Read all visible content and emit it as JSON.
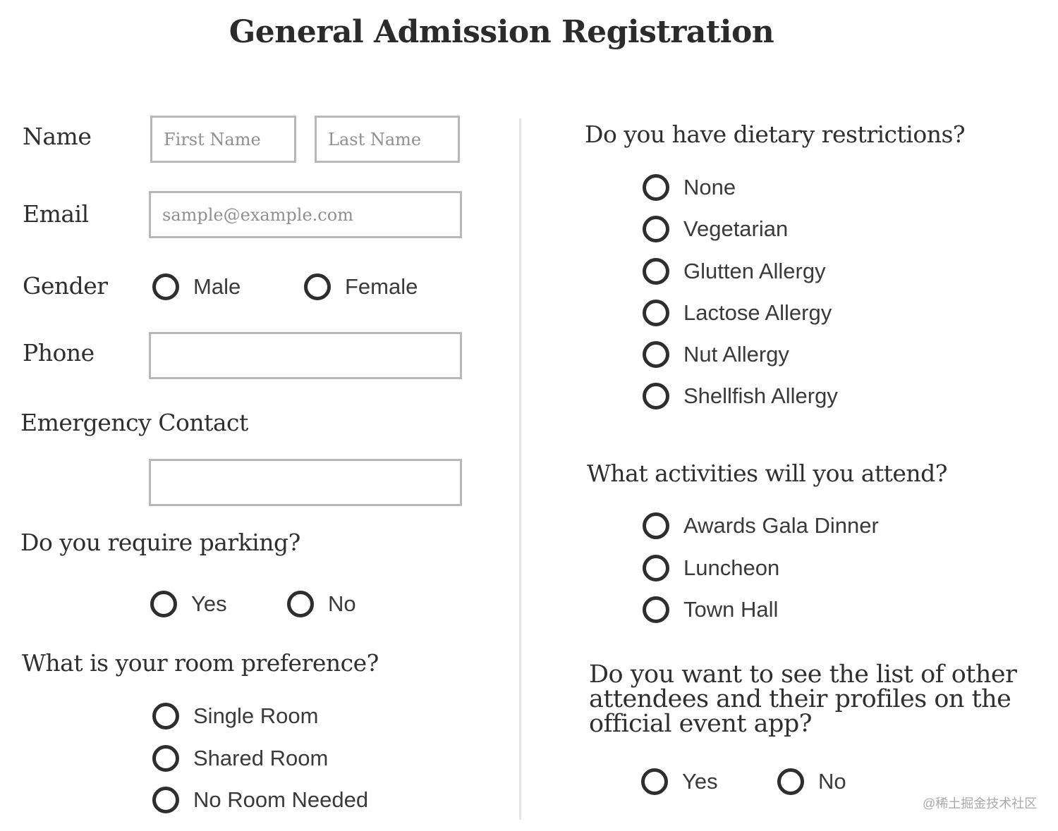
{
  "title": "General Admission Registration",
  "left": {
    "name": {
      "label": "Name",
      "first_placeholder": "First Name",
      "last_placeholder": "Last Name"
    },
    "email": {
      "label": "Email",
      "placeholder": "sample@example.com"
    },
    "gender": {
      "label": "Gender",
      "options": [
        "Male",
        "Female"
      ]
    },
    "phone": {
      "label": "Phone",
      "value": ""
    },
    "emergency": {
      "label": "Emergency Contact",
      "value": ""
    },
    "parking": {
      "question": "Do you require parking?",
      "options": [
        "Yes",
        "No"
      ]
    },
    "room": {
      "question": "What is your room preference?",
      "options": [
        "Single Room",
        "Shared Room",
        "No Room Needed"
      ]
    }
  },
  "right": {
    "dietary": {
      "question": "Do you have dietary restrictions?",
      "options": [
        "None",
        "Vegetarian",
        "Glutten Allergy",
        "Lactose Allergy",
        "Nut Allergy",
        "Shellfish Allergy"
      ]
    },
    "activities": {
      "question": "What activities will you attend?",
      "options": [
        "Awards Gala Dinner",
        "Luncheon",
        "Town Hall"
      ]
    },
    "attendees": {
      "question_lines": [
        "Do you want to see the list of other",
        "attendees and their profiles on the",
        "official event app?"
      ],
      "options": [
        "Yes",
        "No"
      ]
    }
  },
  "watermark": "@稀土掘金技术社区"
}
